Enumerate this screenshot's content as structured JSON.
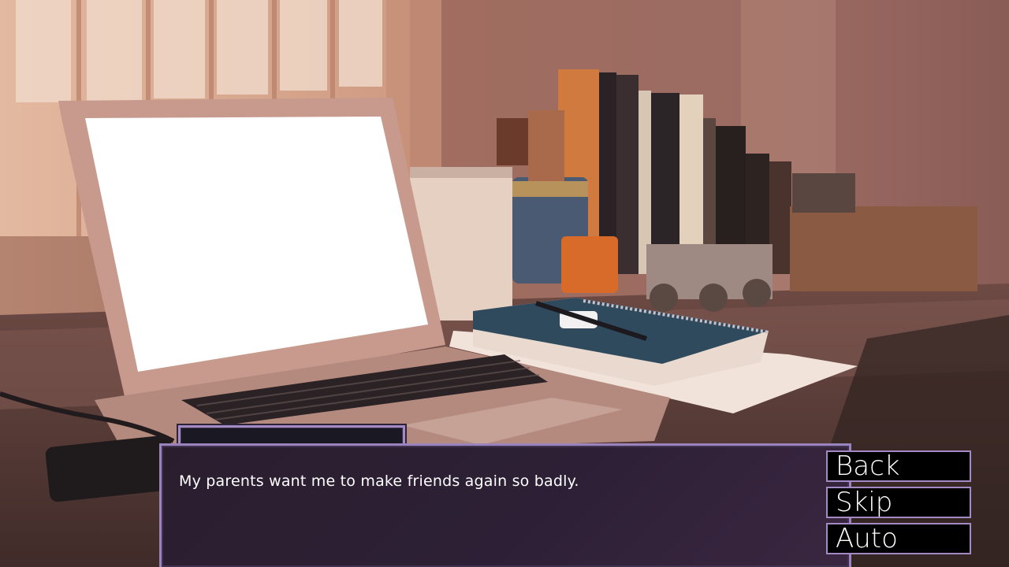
{
  "dialogue": {
    "speaker_name": "",
    "text": "My parents want me to make friends again so badly."
  },
  "quick_menu": {
    "back_label": "Back",
    "skip_label": "Skip",
    "auto_label": "Auto"
  },
  "colors": {
    "textbox_border": "#9b84bd",
    "textbox_bg": "#2d2036",
    "button_bg": "#000000"
  }
}
